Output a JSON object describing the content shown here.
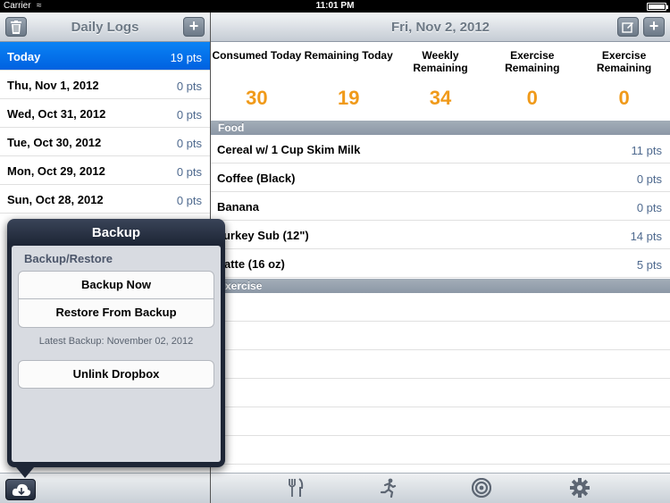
{
  "status": {
    "carrier": "Carrier",
    "time": "11:01 PM"
  },
  "master": {
    "title": "Daily Logs",
    "logs": [
      {
        "date": "Today",
        "pts": "19 pts",
        "selected": true
      },
      {
        "date": "Thu, Nov 1, 2012",
        "pts": "0 pts"
      },
      {
        "date": "Wed, Oct 31, 2012",
        "pts": "0 pts"
      },
      {
        "date": "Tue, Oct 30, 2012",
        "pts": "0 pts"
      },
      {
        "date": "Mon, Oct 29, 2012",
        "pts": "0 pts"
      },
      {
        "date": "Sun, Oct 28, 2012",
        "pts": "0 pts"
      }
    ]
  },
  "detail": {
    "title": "Fri, Nov 2, 2012",
    "stats": [
      {
        "label": "Consumed Today",
        "value": "30"
      },
      {
        "label": "Remaining Today",
        "value": "19"
      },
      {
        "label": "Weekly Remaining",
        "value": "34"
      },
      {
        "label": "Exercise Remaining",
        "value": "0"
      },
      {
        "label": "Exercise Remaining",
        "value": "0"
      }
    ],
    "food_header": "Food",
    "foods": [
      {
        "name": "Cereal w/ 1 Cup Skim Milk",
        "pts": "11 pts"
      },
      {
        "name": "Coffee (Black)",
        "pts": "0 pts"
      },
      {
        "name": "Banana",
        "pts": "0 pts"
      },
      {
        "name": "Turkey Sub (12\")",
        "pts": "14 pts"
      },
      {
        "name": "Latte (16 oz)",
        "pts": "5 pts"
      }
    ],
    "exercise_header": "Exercise"
  },
  "popover": {
    "title": "Backup",
    "section": "Backup/Restore",
    "backup_now": "Backup Now",
    "restore": "Restore From Backup",
    "latest": "Latest Backup: November 02, 2012",
    "unlink": "Unlink Dropbox"
  },
  "colors": {
    "accent": "#f09a1a",
    "selected": "#0a83f5",
    "points": "#4f6a8f"
  },
  "tabs": [
    "food-icon",
    "exercise-icon",
    "goal-icon",
    "settings-icon"
  ]
}
